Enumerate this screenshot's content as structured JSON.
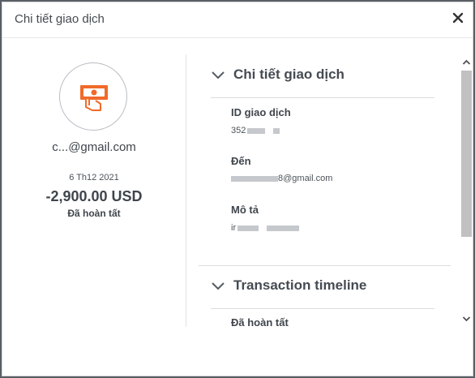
{
  "modal": {
    "title": "Chi tiết giao dịch",
    "close_icon": "close-icon"
  },
  "summary": {
    "icon": "cash-payment-icon",
    "email": "c...@gmail.com",
    "date": "6 Th12 2021",
    "amount": "-2,900.00 USD",
    "status": "Đã hoàn tất"
  },
  "details": {
    "heading": "Chi tiết giao dịch",
    "fields": [
      {
        "label": "ID giao dịch",
        "value": "352"
      },
      {
        "label": "Đến",
        "value": "8@gmail.com"
      },
      {
        "label": "Mô tả",
        "value": "ir"
      }
    ]
  },
  "timeline": {
    "heading": "Transaction timeline",
    "first_status": "Đã hoàn tất"
  },
  "colors": {
    "accent": "#f06a2a",
    "text": "#3f454c",
    "divider": "#dcdcdc"
  }
}
